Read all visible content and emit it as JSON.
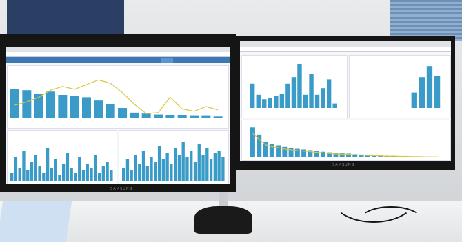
{
  "scene": {
    "description_colors": {
      "bar": "#3a9bc8",
      "navbar": "#3c78b4",
      "line": "#d8c640"
    }
  },
  "left_monitor": {
    "brand": "SAMSUNG",
    "bars_top": [
      0.62,
      0.6,
      0.52,
      0.57,
      0.5,
      0.48,
      0.45,
      0.38,
      0.3,
      0.22,
      0.12,
      0.1,
      0.08,
      0.07,
      0.06,
      0.05,
      0.05,
      0.04
    ],
    "line_top": [
      0.28,
      0.35,
      0.45,
      0.6,
      0.68,
      0.62,
      0.72,
      0.82,
      0.75,
      0.55,
      0.3,
      0.1,
      0.12,
      0.45,
      0.2,
      0.15,
      0.25,
      0.18
    ],
    "bars_bottom_left": [
      0.2,
      0.55,
      0.3,
      0.7,
      0.25,
      0.45,
      0.6,
      0.35,
      0.2,
      0.75,
      0.3,
      0.5,
      0.15,
      0.4,
      0.65,
      0.3,
      0.2,
      0.55,
      0.25,
      0.4,
      0.3,
      0.6,
      0.2,
      0.35,
      0.45,
      0.25
    ],
    "bars_bottom_right": [
      0.3,
      0.5,
      0.25,
      0.6,
      0.4,
      0.7,
      0.35,
      0.55,
      0.45,
      0.8,
      0.5,
      0.65,
      0.4,
      0.75,
      0.6,
      0.9,
      0.55,
      0.7,
      0.45,
      0.85,
      0.6,
      0.75,
      0.5,
      0.65,
      0.7,
      0.55
    ]
  },
  "right_monitor": {
    "brand": "SAMSUNG",
    "bars_top_left": [
      0.55,
      0.3,
      0.2,
      0.22,
      0.28,
      0.32,
      0.55,
      0.7,
      1.0,
      0.3,
      0.78,
      0.3,
      0.45,
      0.65,
      0.1
    ],
    "bars_top_right": [
      0.0,
      0.0,
      0.0,
      0.0,
      0.0,
      0.0,
      0.0,
      0.35,
      0.7,
      0.95,
      0.72
    ],
    "bars_bottom": [
      0.95,
      0.72,
      0.5,
      0.42,
      0.38,
      0.33,
      0.3,
      0.27,
      0.25,
      0.23,
      0.2,
      0.18,
      0.16,
      0.14,
      0.13,
      0.12,
      0.1,
      0.09,
      0.08,
      0.07,
      0.06,
      0.05,
      0.05,
      0.04,
      0.04,
      0.03,
      0.03,
      0.02,
      0.02,
      0.02
    ]
  }
}
